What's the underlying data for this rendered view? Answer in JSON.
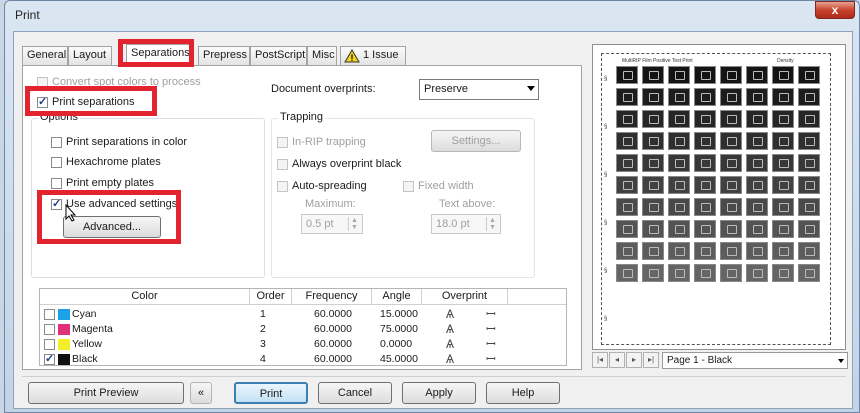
{
  "window": {
    "title": "Print",
    "close_label": "x"
  },
  "tabs": [
    {
      "label": "General"
    },
    {
      "label": "Layout"
    },
    {
      "label": "Separations"
    },
    {
      "label": "Prepress"
    },
    {
      "label": "PostScript"
    },
    {
      "label": "Misc"
    },
    {
      "label": "1 Issue"
    }
  ],
  "separations": {
    "convert_spot_label": "Convert spot colors to process",
    "print_separations_label": "Print separations",
    "document_overprints_label": "Document overprints:",
    "document_overprints_value": "Preserve",
    "options": {
      "group_label": "Options",
      "print_in_color": "Print separations in color",
      "hexachrome": "Hexachrome plates",
      "print_empty": "Print empty plates",
      "use_advanced": "Use advanced settings",
      "advanced_button": "Advanced..."
    },
    "trapping": {
      "group_label": "Trapping",
      "in_rip": "In-RIP trapping",
      "settings_button": "Settings...",
      "always_overprint_black": "Always overprint black",
      "auto_spreading": "Auto-spreading",
      "fixed_width": "Fixed width",
      "maximum_label": "Maximum:",
      "maximum_value": "0.5 pt",
      "text_above_label": "Text above:",
      "text_above_value": "18.0 pt"
    },
    "table": {
      "headers": {
        "color": "Color",
        "order": "Order",
        "frequency": "Frequency",
        "angle": "Angle",
        "overprint": "Overprint"
      },
      "rows": [
        {
          "name": "Cyan",
          "order": "1",
          "frequency": "60.0000",
          "angle": "15.0000",
          "checked": false,
          "swatch": "#1aa3e8"
        },
        {
          "name": "Magenta",
          "order": "2",
          "frequency": "60.0000",
          "angle": "75.0000",
          "checked": false,
          "swatch": "#e0307a"
        },
        {
          "name": "Yellow",
          "order": "3",
          "frequency": "60.0000",
          "angle": "0.0000",
          "checked": false,
          "swatch": "#f2ee2a"
        },
        {
          "name": "Black",
          "order": "4",
          "frequency": "60.0000",
          "angle": "45.0000",
          "checked": true,
          "swatch": "#111111"
        }
      ]
    }
  },
  "preview": {
    "header_text": "MultiRIP Film Positive Test Print",
    "density_label": "Density",
    "page_select": "Page 1 - Black"
  },
  "footer": {
    "print_preview": "Print Preview",
    "collapse_icon": "«",
    "print": "Print",
    "cancel": "Cancel",
    "apply": "Apply",
    "help": "Help"
  },
  "colors": {
    "highlight_red": "#e3232d",
    "accent_blue": "#1b3f8a"
  }
}
